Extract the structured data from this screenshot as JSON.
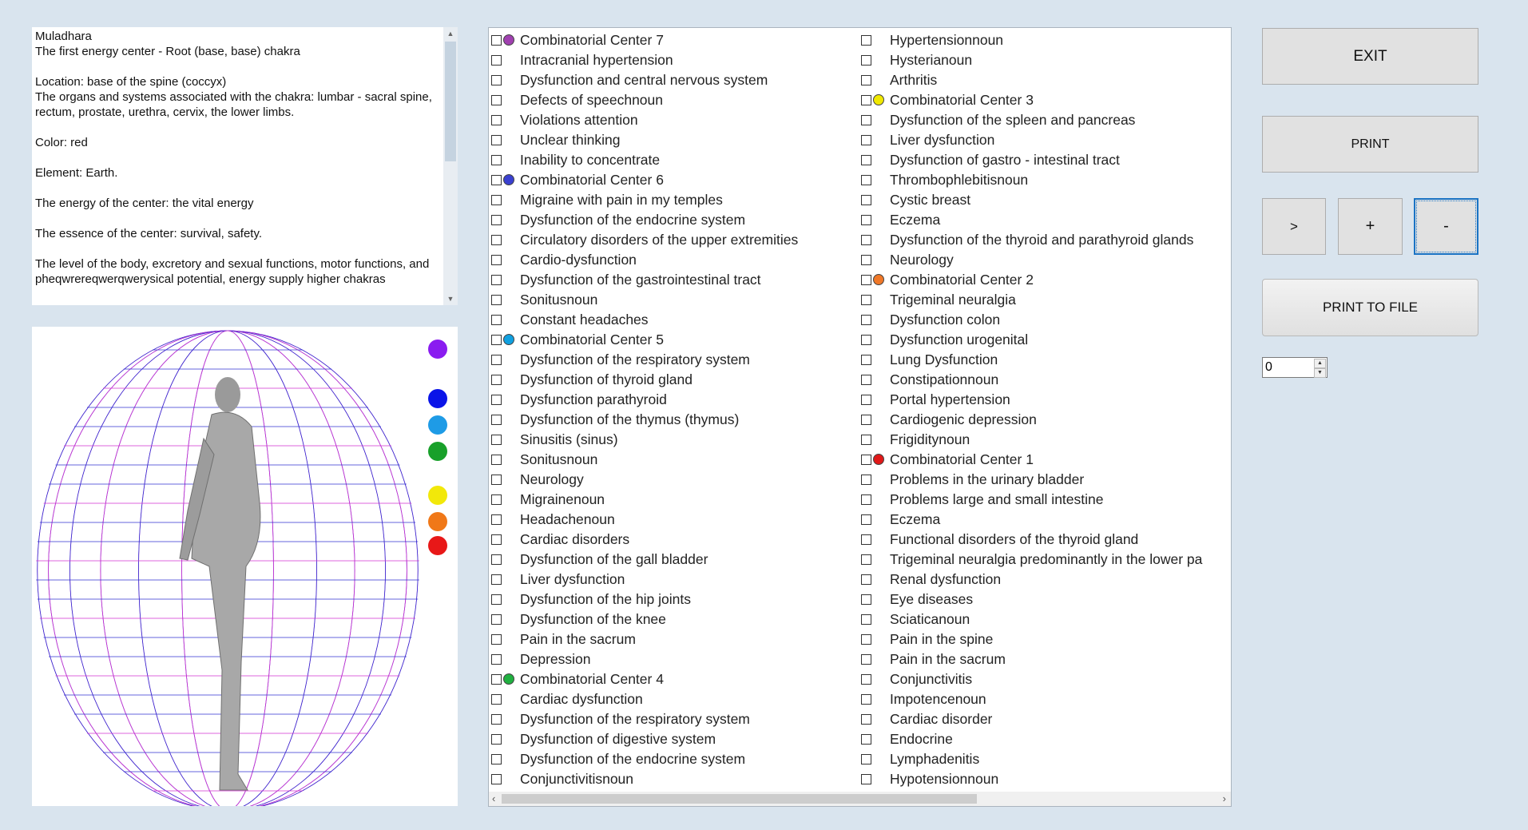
{
  "info_panel": {
    "text": "Muladhara\nThe first energy center - Root (base, base) chakra\n\nLocation: base of the spine (coccyx)\nThe organs and systems associated with the chakra: lumbar - sacral spine, rectum, prostate, urethra, cervix, the lower limbs.\n\nColor: red\n\nElement: Earth.\n\nThe energy of the center: the vital energy\n\nThe essence of the center: survival, safety.\n\nThe level of the body, excretory and sexual functions, motor functions, and pheqwrereqwerqwerysical potential, energy supply higher chakras"
  },
  "chakra_colors": [
    "#8a1cf0",
    "#0a14e8",
    "#1e9be6",
    "#18a02a",
    "#f2e80a",
    "#f07818",
    "#e81818"
  ],
  "list_columns": [
    [
      {
        "label": "Combinatorial Center 7",
        "dot": "#a040b0"
      },
      {
        "label": "Intracranial hypertension"
      },
      {
        "label": "Dysfunction and central nervous system"
      },
      {
        "label": "Defects of speechnoun"
      },
      {
        "label": "Violations attention"
      },
      {
        "label": "Unclear thinking"
      },
      {
        "label": "Inability to concentrate"
      },
      {
        "label": "Combinatorial Center 6",
        "dot": "#3a40d0"
      },
      {
        "label": "Migraine with pain in my temples"
      },
      {
        "label": "Dysfunction of the endocrine system"
      },
      {
        "label": "Circulatory disorders of the upper extremities"
      },
      {
        "label": "Cardio-dysfunction"
      },
      {
        "label": "Dysfunction of the gastrointestinal tract"
      },
      {
        "label": "Sonitusnoun"
      },
      {
        "label": "Constant headaches"
      },
      {
        "label": "Combinatorial Center 5",
        "dot": "#10a0e0"
      },
      {
        "label": "Dysfunction of the respiratory system"
      },
      {
        "label": "Dysfunction of thyroid gland"
      },
      {
        "label": "Dysfunction parathyroid"
      },
      {
        "label": "Dysfunction of the thymus (thymus)"
      },
      {
        "label": "Sinusitis (sinus)"
      },
      {
        "label": "Sonitusnoun"
      },
      {
        "label": "Neurology"
      },
      {
        "label": "Migrainenoun"
      },
      {
        "label": "Headachenoun"
      },
      {
        "label": "Cardiac disorders"
      },
      {
        "label": "Dysfunction of the gall bladder"
      },
      {
        "label": "Liver dysfunction"
      },
      {
        "label": "Dysfunction of the hip joints"
      },
      {
        "label": "Dysfunction of the knee"
      },
      {
        "label": "Pain in the sacrum"
      },
      {
        "label": "Depression"
      },
      {
        "label": "Combinatorial Center 4",
        "dot": "#20b040"
      },
      {
        "label": "Cardiac dysfunction"
      },
      {
        "label": "Dysfunction of the respiratory system"
      },
      {
        "label": "Dysfunction of digestive system"
      },
      {
        "label": "Dysfunction of the endocrine system"
      },
      {
        "label": "Conjunctivitisnoun"
      }
    ],
    [
      {
        "label": "Hypertensionnoun"
      },
      {
        "label": "Hysterianoun"
      },
      {
        "label": "Arthritis"
      },
      {
        "label": "Combinatorial Center 3",
        "dot": "#f0e800"
      },
      {
        "label": "Dysfunction of the spleen and pancreas"
      },
      {
        "label": "Liver dysfunction"
      },
      {
        "label": "Dysfunction of gastro - intestinal tract"
      },
      {
        "label": "Thrombophlebitisnoun"
      },
      {
        "label": "Cystic breast"
      },
      {
        "label": "Eczema"
      },
      {
        "label": "Dysfunction of the thyroid and parathyroid glands"
      },
      {
        "label": "Neurology"
      },
      {
        "label": "Combinatorial Center 2",
        "dot": "#f07828"
      },
      {
        "label": "Trigeminal neuralgia"
      },
      {
        "label": "Dysfunction colon"
      },
      {
        "label": "Dysfunction urogenital"
      },
      {
        "label": "Lung Dysfunction"
      },
      {
        "label": "Constipationnoun"
      },
      {
        "label": "Portal hypertension"
      },
      {
        "label": "Cardiogenic depression"
      },
      {
        "label": "Frigiditynoun"
      },
      {
        "label": "Combinatorial Center 1",
        "dot": "#e01818"
      },
      {
        "label": "Problems in the urinary bladder"
      },
      {
        "label": "Problems large and small intestine"
      },
      {
        "label": "Eczema"
      },
      {
        "label": "Functional disorders of the thyroid gland"
      },
      {
        "label": "Trigeminal neuralgia predominantly in the lower pa"
      },
      {
        "label": "Renal dysfunction"
      },
      {
        "label": "Eye diseases"
      },
      {
        "label": "Sciaticanoun"
      },
      {
        "label": "Pain in the spine"
      },
      {
        "label": "Pain in the sacrum"
      },
      {
        "label": "Conjunctivitis"
      },
      {
        "label": "Impotencenoun"
      },
      {
        "label": "Cardiac disorder"
      },
      {
        "label": "Endocrine"
      },
      {
        "label": "Lymphadenitis"
      },
      {
        "label": "Hypotensionnoun"
      }
    ]
  ],
  "buttons": {
    "exit": "EXIT",
    "print": "PRINT",
    "next": ">",
    "plus": "+",
    "minus": "-",
    "print_to_file": "PRINT TO FILE"
  },
  "spinner": {
    "value": "0"
  }
}
